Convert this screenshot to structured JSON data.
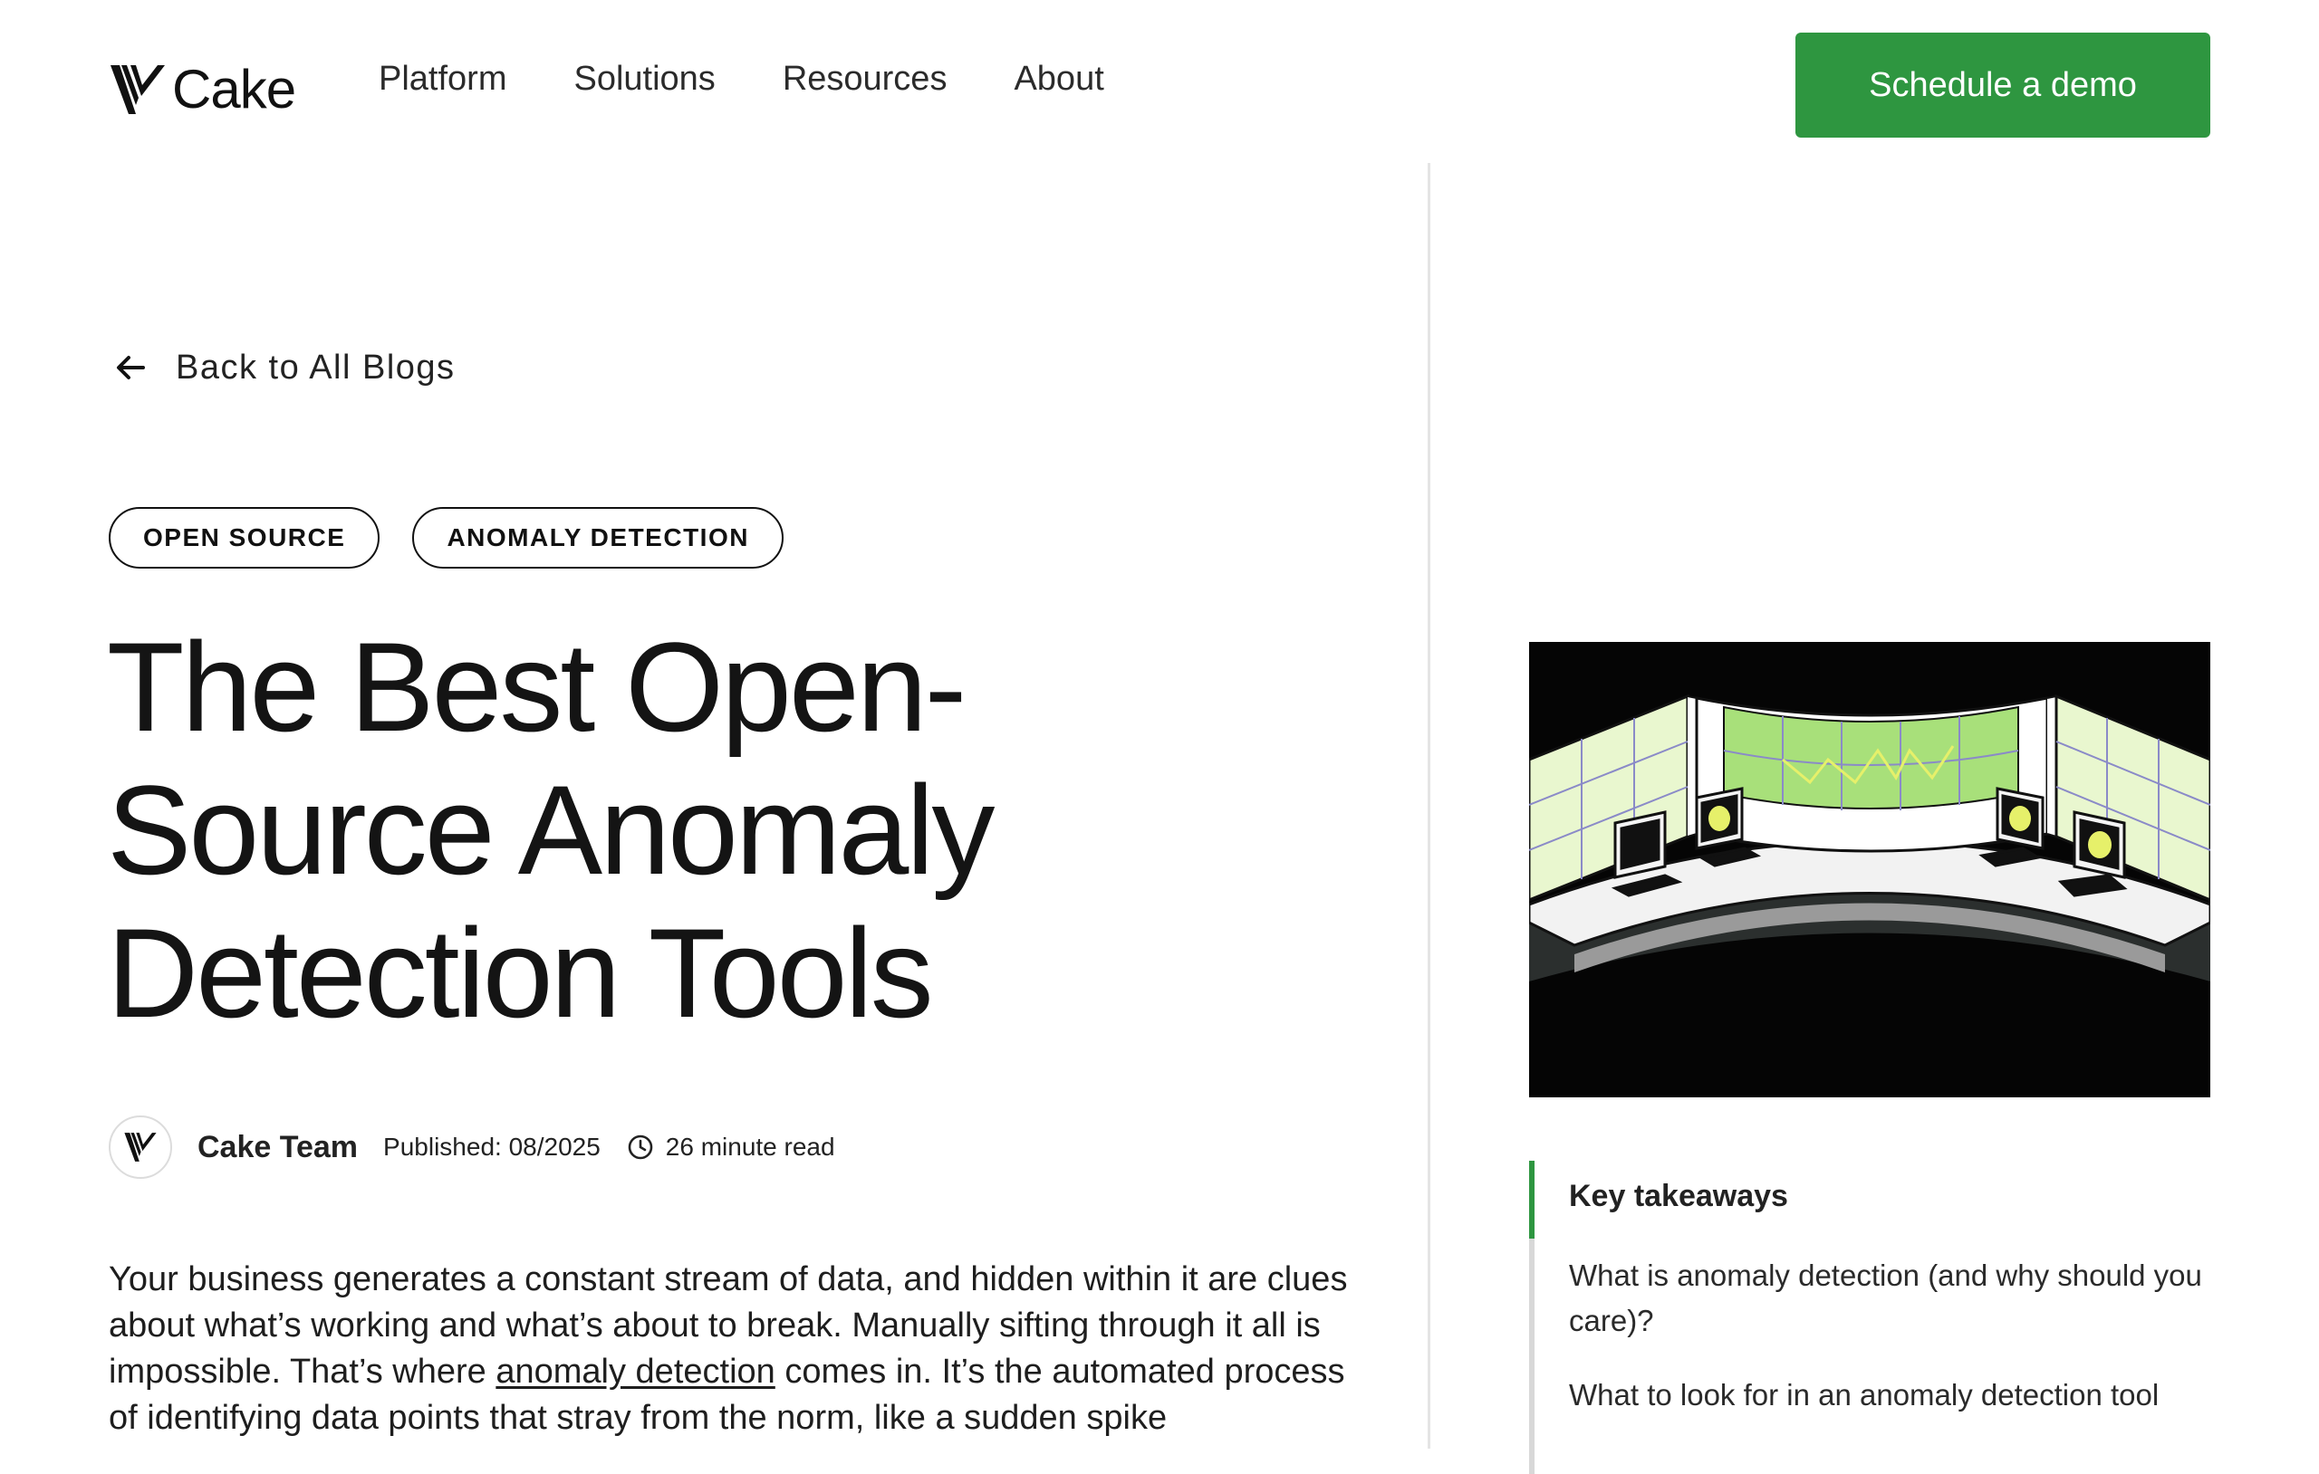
{
  "header": {
    "logo_text": "Cake",
    "nav": [
      "Platform",
      "Solutions",
      "Resources",
      "About"
    ],
    "cta_label": "Schedule a demo"
  },
  "article": {
    "back_label": "Back to All Blogs",
    "tags": [
      "OPEN SOURCE",
      "ANOMALY DETECTION"
    ],
    "title": "The Best Open-Source Anomaly Detection Tools",
    "author": "Cake Team",
    "published": "Published: 08/2025",
    "read_time": "26 minute read",
    "body": {
      "before_link": "Your business generates a constant stream of data, and hidden within it are clues about what’s working and what’s about to break. Manually sifting through it all is impossible. That’s where ",
      "link_text": "anomaly detection",
      "after_link": " comes in. It’s the automated process of identifying data points that stray from the norm, like a sudden spike"
    }
  },
  "sidebar": {
    "takeaways_title": "Key takeaways",
    "takeaways": [
      "What is anomaly detection (and why should you care)?",
      "What to look for in an anomaly detection tool"
    ]
  },
  "colors": {
    "accent_green": "#2e9640",
    "screen_green": "#a8e07a",
    "monitor_yellow": "#e6f06a"
  },
  "icons": {
    "logo": "cake-logo-icon",
    "back": "arrow-left-icon",
    "clock": "clock-icon"
  }
}
